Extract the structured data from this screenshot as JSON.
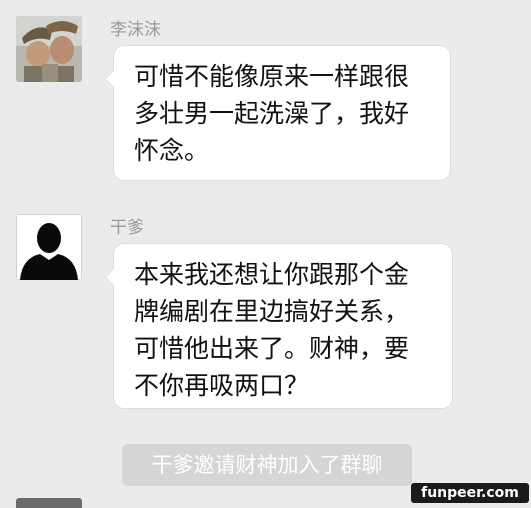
{
  "messages": [
    {
      "sender": "李沫沫",
      "lines": [
        "可惜不能像原来一样跟很",
        "多壮男一起洗澡了，我好",
        "怀念。"
      ],
      "avatar": "photo-avatar"
    },
    {
      "sender": "干爹",
      "lines": [
        "本来我还想让你跟那个金",
        "牌编剧在里边搞好关系，",
        "可惜他出来了。财神，要",
        "不你再吸两口？"
      ],
      "avatar": "default-silhouette-avatar"
    }
  ],
  "system_notice": "干爹邀请财神加入了群聊",
  "watermark": "funpeer.com"
}
